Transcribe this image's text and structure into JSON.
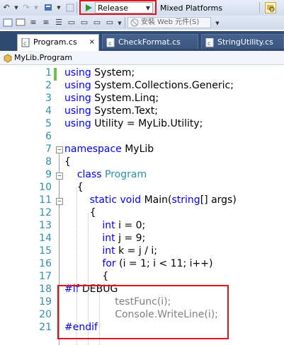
{
  "toolbar": {
    "configuration": "Release",
    "platform": "Mixed Platforms",
    "install_web_components": "安裝 Web 元件(S)"
  },
  "tabs": [
    {
      "label": "Program.cs",
      "close": "×",
      "active": true
    },
    {
      "label": "CheckFormat.cs",
      "active": false
    },
    {
      "label": "StringUtility.cs",
      "active": false
    }
  ],
  "navbar": {
    "class": "MyLib.Program"
  },
  "editor": {
    "lines": [
      {
        "num": "1",
        "tokens": [
          {
            "t": "using",
            "c": "kw"
          },
          {
            "t": " System;"
          }
        ]
      },
      {
        "num": "2",
        "tokens": [
          {
            "t": "using",
            "c": "kw"
          },
          {
            "t": " System.Collections.Generic;"
          }
        ]
      },
      {
        "num": "3",
        "tokens": [
          {
            "t": "using",
            "c": "kw"
          },
          {
            "t": " System.Linq;"
          }
        ]
      },
      {
        "num": "4",
        "tokens": [
          {
            "t": "using",
            "c": "kw"
          },
          {
            "t": " System.Text;"
          }
        ]
      },
      {
        "num": "5",
        "tokens": [
          {
            "t": "using",
            "c": "kw"
          },
          {
            "t": " Utility = MyLib.Utility;"
          }
        ]
      },
      {
        "num": "6",
        "tokens": []
      },
      {
        "num": "7",
        "tokens": [
          {
            "t": "namespace",
            "c": "kw"
          },
          {
            "t": " MyLib"
          }
        ]
      },
      {
        "num": "8",
        "tokens": [
          {
            "t": "{"
          }
        ]
      },
      {
        "num": "9",
        "tokens": [
          {
            "t": "    "
          },
          {
            "t": "class",
            "c": "kw"
          },
          {
            "t": " "
          },
          {
            "t": "Program",
            "c": "tp"
          }
        ]
      },
      {
        "num": "10",
        "tokens": [
          {
            "t": "    {"
          }
        ]
      },
      {
        "num": "11",
        "tokens": [
          {
            "t": "        "
          },
          {
            "t": "static",
            "c": "kw"
          },
          {
            "t": " "
          },
          {
            "t": "void",
            "c": "kw"
          },
          {
            "t": " Main("
          },
          {
            "t": "string",
            "c": "kw"
          },
          {
            "t": "[] args)"
          }
        ]
      },
      {
        "num": "12",
        "tokens": [
          {
            "t": "        {"
          }
        ]
      },
      {
        "num": "13",
        "tokens": [
          {
            "t": "            "
          },
          {
            "t": "int",
            "c": "kw"
          },
          {
            "t": " i = 0;"
          }
        ]
      },
      {
        "num": "14",
        "tokens": [
          {
            "t": "            "
          },
          {
            "t": "int",
            "c": "kw"
          },
          {
            "t": " j = 9;"
          }
        ]
      },
      {
        "num": "15",
        "tokens": [
          {
            "t": "            "
          },
          {
            "t": "int",
            "c": "kw"
          },
          {
            "t": " k = j / i;"
          }
        ]
      },
      {
        "num": "16",
        "tokens": [
          {
            "t": "            "
          },
          {
            "t": "for",
            "c": "kw"
          },
          {
            "t": " (i = 1; i < 11; i++)"
          }
        ]
      },
      {
        "num": "17",
        "tokens": [
          {
            "t": "            {"
          }
        ]
      },
      {
        "num": "18",
        "tokens": [
          {
            "t": "#if",
            "c": "kw"
          },
          {
            "t": " DEBUG"
          }
        ]
      },
      {
        "num": "19",
        "tokens": [
          {
            "t": "                testFunc(i);",
            "c": "gr"
          }
        ]
      },
      {
        "num": "20",
        "tokens": [
          {
            "t": "                Console.WriteLine(i);",
            "c": "gr"
          }
        ]
      },
      {
        "num": "21",
        "tokens": [
          {
            "t": "#endif",
            "c": "kw"
          }
        ]
      }
    ]
  }
}
